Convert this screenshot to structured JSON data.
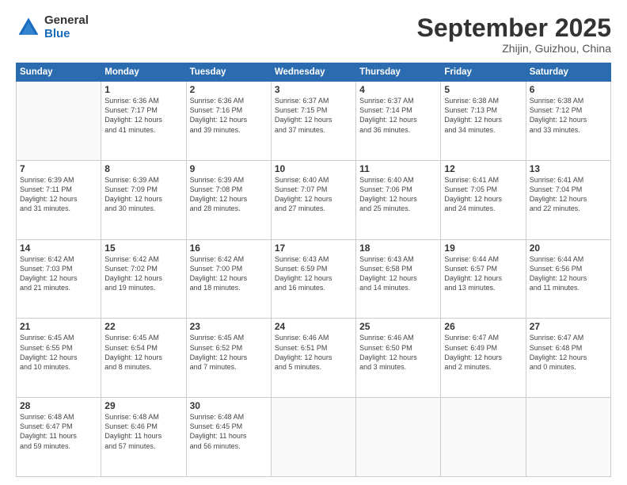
{
  "logo": {
    "general": "General",
    "blue": "Blue"
  },
  "header": {
    "month": "September 2025",
    "location": "Zhijin, Guizhou, China"
  },
  "weekdays": [
    "Sunday",
    "Monday",
    "Tuesday",
    "Wednesday",
    "Thursday",
    "Friday",
    "Saturday"
  ],
  "weeks": [
    [
      {
        "day": "",
        "info": ""
      },
      {
        "day": "1",
        "info": "Sunrise: 6:36 AM\nSunset: 7:17 PM\nDaylight: 12 hours\nand 41 minutes."
      },
      {
        "day": "2",
        "info": "Sunrise: 6:36 AM\nSunset: 7:16 PM\nDaylight: 12 hours\nand 39 minutes."
      },
      {
        "day": "3",
        "info": "Sunrise: 6:37 AM\nSunset: 7:15 PM\nDaylight: 12 hours\nand 37 minutes."
      },
      {
        "day": "4",
        "info": "Sunrise: 6:37 AM\nSunset: 7:14 PM\nDaylight: 12 hours\nand 36 minutes."
      },
      {
        "day": "5",
        "info": "Sunrise: 6:38 AM\nSunset: 7:13 PM\nDaylight: 12 hours\nand 34 minutes."
      },
      {
        "day": "6",
        "info": "Sunrise: 6:38 AM\nSunset: 7:12 PM\nDaylight: 12 hours\nand 33 minutes."
      }
    ],
    [
      {
        "day": "7",
        "info": "Sunrise: 6:39 AM\nSunset: 7:11 PM\nDaylight: 12 hours\nand 31 minutes."
      },
      {
        "day": "8",
        "info": "Sunrise: 6:39 AM\nSunset: 7:09 PM\nDaylight: 12 hours\nand 30 minutes."
      },
      {
        "day": "9",
        "info": "Sunrise: 6:39 AM\nSunset: 7:08 PM\nDaylight: 12 hours\nand 28 minutes."
      },
      {
        "day": "10",
        "info": "Sunrise: 6:40 AM\nSunset: 7:07 PM\nDaylight: 12 hours\nand 27 minutes."
      },
      {
        "day": "11",
        "info": "Sunrise: 6:40 AM\nSunset: 7:06 PM\nDaylight: 12 hours\nand 25 minutes."
      },
      {
        "day": "12",
        "info": "Sunrise: 6:41 AM\nSunset: 7:05 PM\nDaylight: 12 hours\nand 24 minutes."
      },
      {
        "day": "13",
        "info": "Sunrise: 6:41 AM\nSunset: 7:04 PM\nDaylight: 12 hours\nand 22 minutes."
      }
    ],
    [
      {
        "day": "14",
        "info": "Sunrise: 6:42 AM\nSunset: 7:03 PM\nDaylight: 12 hours\nand 21 minutes."
      },
      {
        "day": "15",
        "info": "Sunrise: 6:42 AM\nSunset: 7:02 PM\nDaylight: 12 hours\nand 19 minutes."
      },
      {
        "day": "16",
        "info": "Sunrise: 6:42 AM\nSunset: 7:00 PM\nDaylight: 12 hours\nand 18 minutes."
      },
      {
        "day": "17",
        "info": "Sunrise: 6:43 AM\nSunset: 6:59 PM\nDaylight: 12 hours\nand 16 minutes."
      },
      {
        "day": "18",
        "info": "Sunrise: 6:43 AM\nSunset: 6:58 PM\nDaylight: 12 hours\nand 14 minutes."
      },
      {
        "day": "19",
        "info": "Sunrise: 6:44 AM\nSunset: 6:57 PM\nDaylight: 12 hours\nand 13 minutes."
      },
      {
        "day": "20",
        "info": "Sunrise: 6:44 AM\nSunset: 6:56 PM\nDaylight: 12 hours\nand 11 minutes."
      }
    ],
    [
      {
        "day": "21",
        "info": "Sunrise: 6:45 AM\nSunset: 6:55 PM\nDaylight: 12 hours\nand 10 minutes."
      },
      {
        "day": "22",
        "info": "Sunrise: 6:45 AM\nSunset: 6:54 PM\nDaylight: 12 hours\nand 8 minutes."
      },
      {
        "day": "23",
        "info": "Sunrise: 6:45 AM\nSunset: 6:52 PM\nDaylight: 12 hours\nand 7 minutes."
      },
      {
        "day": "24",
        "info": "Sunrise: 6:46 AM\nSunset: 6:51 PM\nDaylight: 12 hours\nand 5 minutes."
      },
      {
        "day": "25",
        "info": "Sunrise: 6:46 AM\nSunset: 6:50 PM\nDaylight: 12 hours\nand 3 minutes."
      },
      {
        "day": "26",
        "info": "Sunrise: 6:47 AM\nSunset: 6:49 PM\nDaylight: 12 hours\nand 2 minutes."
      },
      {
        "day": "27",
        "info": "Sunrise: 6:47 AM\nSunset: 6:48 PM\nDaylight: 12 hours\nand 0 minutes."
      }
    ],
    [
      {
        "day": "28",
        "info": "Sunrise: 6:48 AM\nSunset: 6:47 PM\nDaylight: 11 hours\nand 59 minutes."
      },
      {
        "day": "29",
        "info": "Sunrise: 6:48 AM\nSunset: 6:46 PM\nDaylight: 11 hours\nand 57 minutes."
      },
      {
        "day": "30",
        "info": "Sunrise: 6:48 AM\nSunset: 6:45 PM\nDaylight: 11 hours\nand 56 minutes."
      },
      {
        "day": "",
        "info": ""
      },
      {
        "day": "",
        "info": ""
      },
      {
        "day": "",
        "info": ""
      },
      {
        "day": "",
        "info": ""
      }
    ]
  ]
}
